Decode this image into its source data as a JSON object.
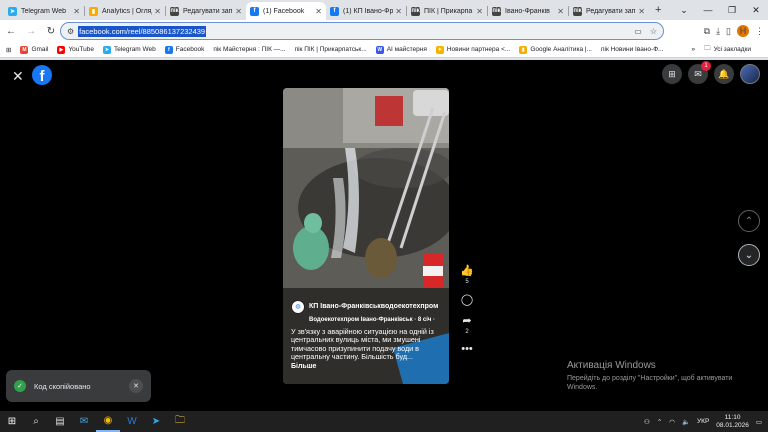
{
  "browser": {
    "tabs": [
      {
        "label": "Telegram Web",
        "favicon_color": "#2aabee",
        "favicon_text": "➤",
        "active": false
      },
      {
        "label": "Analytics | Огляд",
        "favicon_color": "#f9ab00",
        "favicon_text": "▮",
        "active": false
      },
      {
        "label": "Редагувати запис",
        "favicon_color": "#444444",
        "favicon_text": "пік",
        "active": false
      },
      {
        "label": "(1) Facebook",
        "favicon_color": "#1877f2",
        "favicon_text": "f",
        "active": true
      },
      {
        "label": "(1) КП Івано-Фр",
        "favicon_color": "#1877f2",
        "favicon_text": "f",
        "active": false
      },
      {
        "label": "ПІК | Прикарпа",
        "favicon_color": "#444444",
        "favicon_text": "пік",
        "active": false
      },
      {
        "label": "Івано-Франків",
        "favicon_color": "#444444",
        "favicon_text": "пік",
        "active": false
      },
      {
        "label": "Редагувати запис",
        "favicon_color": "#444444",
        "favicon_text": "пік",
        "active": false
      }
    ],
    "url": "facebook.com/reel/885086137232439",
    "bookmarks": [
      {
        "label": "Gmail",
        "color": "#ea4335",
        "icon": "M"
      },
      {
        "label": "YouTube",
        "color": "#ff0000",
        "icon": "▶"
      },
      {
        "label": "Telegram Web",
        "color": "#2aabee",
        "icon": "➤"
      },
      {
        "label": "Facebook",
        "color": "#1877f2",
        "icon": "f"
      },
      {
        "label": "пік Майстерня : ПІК —...",
        "color": "#ffffff",
        "icon": ""
      },
      {
        "label": "пік ПІК | Прикарпатськ...",
        "color": "#ffffff",
        "icon": ""
      },
      {
        "label": "AI майстерня",
        "color": "#3858e9",
        "icon": "W"
      },
      {
        "label": "Новини партнера <...",
        "color": "#f4b400",
        "icon": "✦"
      },
      {
        "label": "Google Аналітика |...",
        "color": "#f9ab00",
        "icon": "▮"
      },
      {
        "label": "пік Новини Івано-Ф...",
        "color": "#ffffff",
        "icon": ""
      }
    ],
    "all_bookmarks_label": "Усі закладки",
    "profile_letter": "Н"
  },
  "reel": {
    "page_name": "КП Івано-Франківськводоекотехпром",
    "sub_line": "Водоекотехпром Івано-Франківськ · 8 січ ·",
    "caption": "У зв'язку з аварійною ситуацією на одній із центральних вулиць міста, ми змушені тимчасово призупинити подачу води в центральну частину. Більшість буд...",
    "more_label": "Більше",
    "likes": "5",
    "shares": "2"
  },
  "notifications": {
    "badge": "1"
  },
  "toast": {
    "text": "Код скопійовано"
  },
  "watermark": {
    "title": "Активація Windows",
    "body": "Перейдіть до розділу \"Настройки\", щоб активувати Windows."
  },
  "taskbar": {
    "lang": "УКР",
    "time": "11:10",
    "date": "08.01.2026"
  }
}
